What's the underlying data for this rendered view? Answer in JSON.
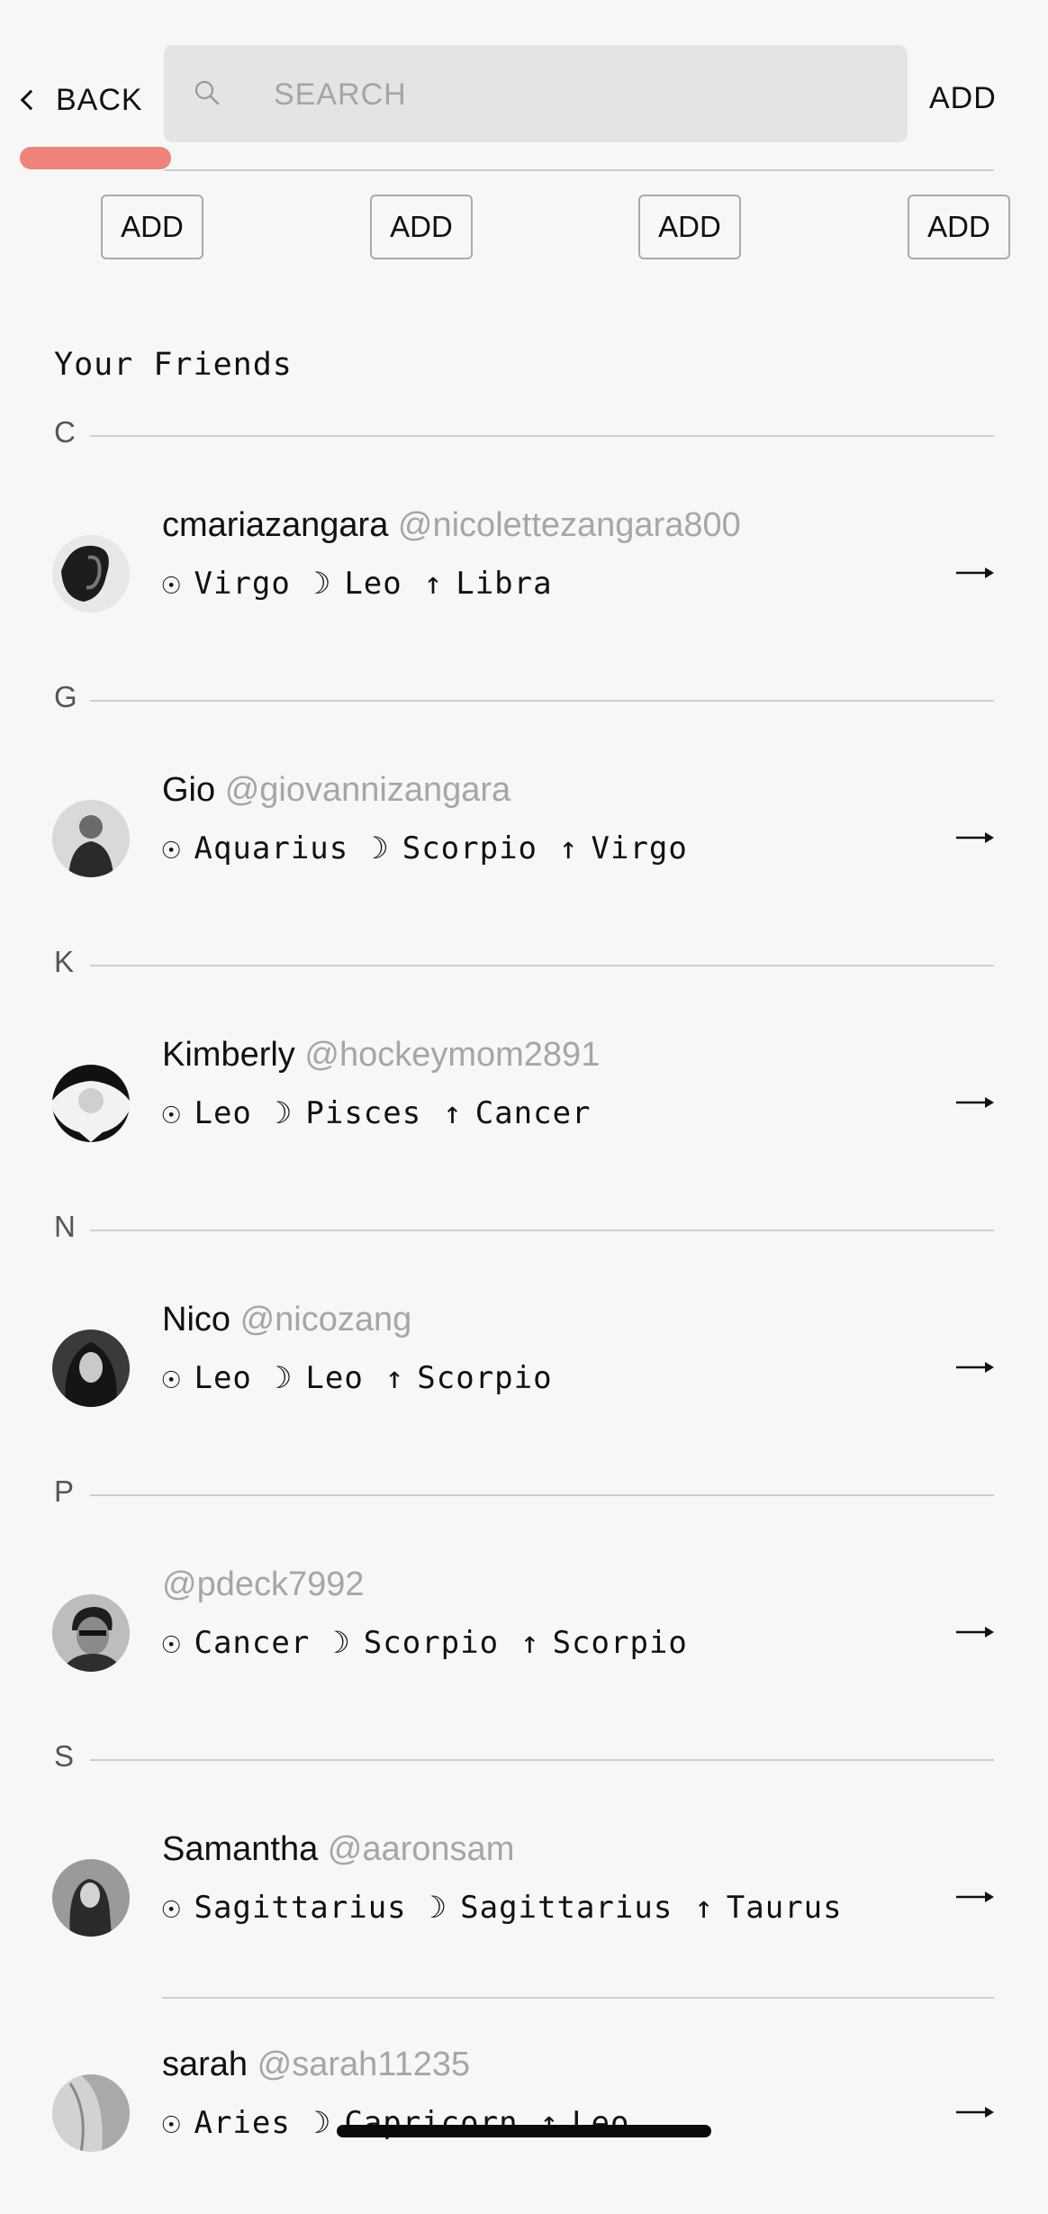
{
  "header": {
    "back_label": "BACK",
    "search_placeholder": "SEARCH",
    "add_label": "ADD",
    "highlight_color": "#ee7b72"
  },
  "add_buttons": [
    "ADD",
    "ADD",
    "ADD",
    "ADD"
  ],
  "friends_title": "Your Friends",
  "symbols": {
    "sun": "☉",
    "moon": "☽",
    "rising": "↑"
  },
  "sections": [
    {
      "letter": "C",
      "friends": [
        {
          "name": "cmariazangara",
          "handle": "@nicolettezangara800",
          "sun": "Virgo",
          "moon": "Leo",
          "rising": "Libra"
        }
      ]
    },
    {
      "letter": "G",
      "friends": [
        {
          "name": "Gio",
          "handle": "@giovannizangara",
          "sun": "Aquarius",
          "moon": "Scorpio",
          "rising": "Virgo"
        }
      ]
    },
    {
      "letter": "K",
      "friends": [
        {
          "name": "Kimberly",
          "handle": "@hockeymom2891",
          "sun": "Leo",
          "moon": "Pisces",
          "rising": "Cancer"
        }
      ]
    },
    {
      "letter": "N",
      "friends": [
        {
          "name": "Nico",
          "handle": "@nicozang",
          "sun": "Leo",
          "moon": "Leo",
          "rising": "Scorpio"
        }
      ]
    },
    {
      "letter": "P",
      "friends": [
        {
          "name": "",
          "handle": "@pdeck7992",
          "sun": "Cancer",
          "moon": "Scorpio",
          "rising": "Scorpio"
        }
      ]
    },
    {
      "letter": "S",
      "friends": [
        {
          "name": "Samantha",
          "handle": "@aaronsam",
          "sun": "Sagittarius",
          "moon": "Sagittarius",
          "rising": "Taurus"
        },
        {
          "name": "sarah",
          "handle": "@sarah11235",
          "sun": "Aries",
          "moon": "Capricorn",
          "rising": "Leo"
        }
      ]
    }
  ]
}
